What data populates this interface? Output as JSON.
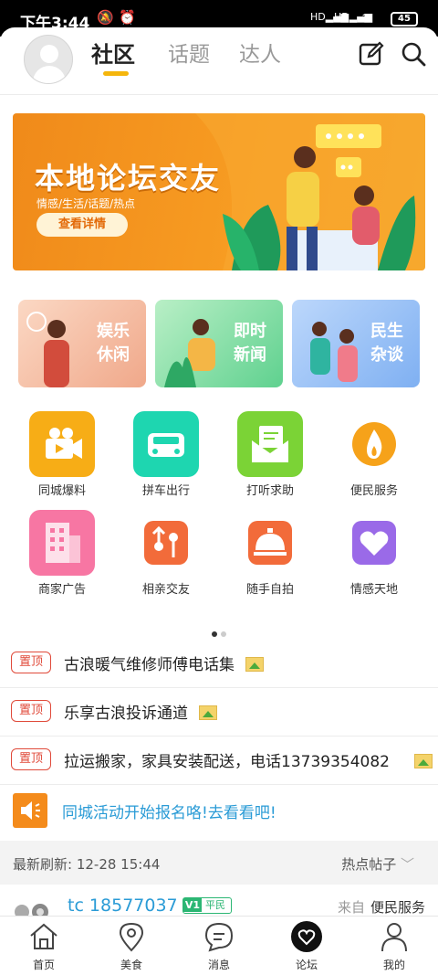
{
  "status_bar": {
    "time": "下午3:44",
    "battery": "45",
    "signal": "HD"
  },
  "header": {
    "tabs": [
      {
        "label": "社区"
      },
      {
        "label": "话题"
      },
      {
        "label": "达人"
      }
    ],
    "accent_color": "#f5b60c"
  },
  "banner": {
    "title": "本地论坛交友",
    "subtitle": "情感/生活/话题/热点",
    "button": "查看详情"
  },
  "cards": [
    {
      "line1": "娱乐",
      "line2": "休闲"
    },
    {
      "line1": "即时",
      "line2": "新闻"
    },
    {
      "line1": "民生",
      "line2": "杂谈"
    }
  ],
  "grid": [
    {
      "label": "同城爆料",
      "icon": "video-camera-icon"
    },
    {
      "label": "拼车出行",
      "icon": "car-icon"
    },
    {
      "label": "打听求助",
      "icon": "envelope-icon"
    },
    {
      "label": "便民服务",
      "icon": "flame-icon"
    },
    {
      "label": "商家广告",
      "icon": "building-icon"
    },
    {
      "label": "相亲交友",
      "icon": "dating-icon"
    },
    {
      "label": "随手自拍",
      "icon": "cloche-icon"
    },
    {
      "label": "情感天地",
      "icon": "heart-icon"
    }
  ],
  "pinned": {
    "tag": "置顶",
    "items": [
      "古浪暖气维修师傅电话集",
      "乐享古浪投诉通道",
      "拉运搬家，家具安装配送，电话13739354082"
    ]
  },
  "notice": "同城活动开始报名咯!去看看吧!",
  "feed": {
    "refresh_label": "最新刷新: 12-28 15:44",
    "sort_label": "热点帖子"
  },
  "post": {
    "username": "tc  18577037",
    "level_badge": "V1",
    "level_name": "平民",
    "from_label": "来自",
    "from_forum": "便民服务"
  },
  "bottom_nav": [
    {
      "label": "首页"
    },
    {
      "label": "美食"
    },
    {
      "label": "消息"
    },
    {
      "label": "论坛"
    },
    {
      "label": "我的"
    }
  ]
}
